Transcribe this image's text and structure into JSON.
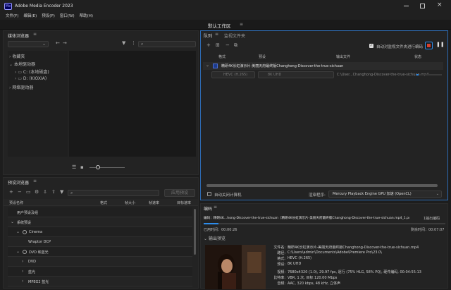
{
  "app": {
    "title": "Adobe Media Encoder 2023",
    "logo_text": "Me",
    "colors": {
      "accent": "#2d8ceb",
      "brand": "#00005b",
      "stop": "#d8412f"
    }
  },
  "menu": [
    "文件(F)",
    "编辑(E)",
    "预设(P)",
    "窗口(W)",
    "帮助(H)"
  ],
  "workspace": {
    "label": "默认工作区"
  },
  "media_browser": {
    "title": "媒体浏览器",
    "tree": [
      {
        "label": "收藏夹",
        "indent": 0
      },
      {
        "label": "本地驱动器",
        "indent": 0
      },
      {
        "label": "C: (本地磁盘)",
        "indent": 1
      },
      {
        "label": "D: (KIOXIA)",
        "indent": 1
      },
      {
        "label": "网络驱动器",
        "indent": 0
      }
    ]
  },
  "preset_browser": {
    "title": "预设浏览器",
    "apply_button": "应用预设",
    "columns": [
      "预设名称",
      "格式",
      "帧大小",
      "帧速率",
      "目标速率"
    ],
    "rows": [
      {
        "label": "用户预设及组",
        "indent": 0,
        "arrow": false,
        "icon": false
      },
      {
        "label": "系统预设",
        "indent": 0,
        "arrow": true,
        "icon": false
      },
      {
        "label": "Cinema",
        "indent": 1,
        "arrow": true,
        "icon": true
      },
      {
        "label": "Wraptor DCP",
        "indent": 2,
        "arrow": false,
        "icon": false
      },
      {
        "label": "DVD 和蓝光",
        "indent": 1,
        "arrow": true,
        "icon": true
      },
      {
        "label": "DVD",
        "indent": 2,
        "arrow": true,
        "icon": false
      },
      {
        "label": "蓝光",
        "indent": 2,
        "arrow": true,
        "icon": false
      },
      {
        "label": "MPEG2 蓝光",
        "indent": 2,
        "arrow": true,
        "icon": false
      }
    ]
  },
  "queue": {
    "tabs": [
      "队列",
      "监视文件夹"
    ],
    "auto_encode_label": "自动对监视文件夹进行编码",
    "columns": [
      "格式",
      "预设",
      "输出文件",
      "状态"
    ],
    "item": {
      "name": "精研4K长虹演示片-美丽天府最终版Changhong-Discover-the-true-sichuan",
      "format": "HEVC (H.265)",
      "preset": "8K UHD",
      "output": "C:\\User...Changhong-Discover-the-true-sichuan.mp4",
      "progress": 0.08
    },
    "auto_shutdown_label": "自动关闭计算机",
    "renderer_label": "渲染程序:",
    "renderer_value": "Mercury Playback Engine GPU 加速 (OpenCL)"
  },
  "encoding": {
    "title": "编码",
    "file_line": "编码：精研4K...hong-Discover-the-true-sichuan（精研4K长虹演示片-美丽天府最终版Changhong-Discover-the-true-sichuan.mp4_1.prproj）",
    "outputs": "1输出编码",
    "progress": 0.06,
    "elapsed_label": "已用时间：00:00:26",
    "remaining_label": "剩余时间：00:07:07",
    "preview_label": "输出预览",
    "details": [
      {
        "k": "文件名:",
        "v": "精研4K长虹演示片-美丽天府最终版Changhong-Discover-the-true-sichuan.mp4"
      },
      {
        "k": "路径:",
        "v": "C:\\Users\\admin\\Documents\\Adobe\\Premiere Pro\\23.0\\"
      },
      {
        "k": "格式:",
        "v": "HEVC (H.265)"
      },
      {
        "k": "预设:",
        "v": "8K UHD"
      },
      {
        "k": "视频:",
        "v": "7680x4320 (1.0), 29.97 fps, 逐行 (75% HLG, 58% PQ), 硬件编码, 00:04:55:13"
      },
      {
        "k": "比特率:",
        "v": "VBR, 1 次, 目标 120.00 Mbps"
      },
      {
        "k": "音频:",
        "v": "AAC, 320 kbps, 48 kHz, 立体声"
      }
    ]
  }
}
